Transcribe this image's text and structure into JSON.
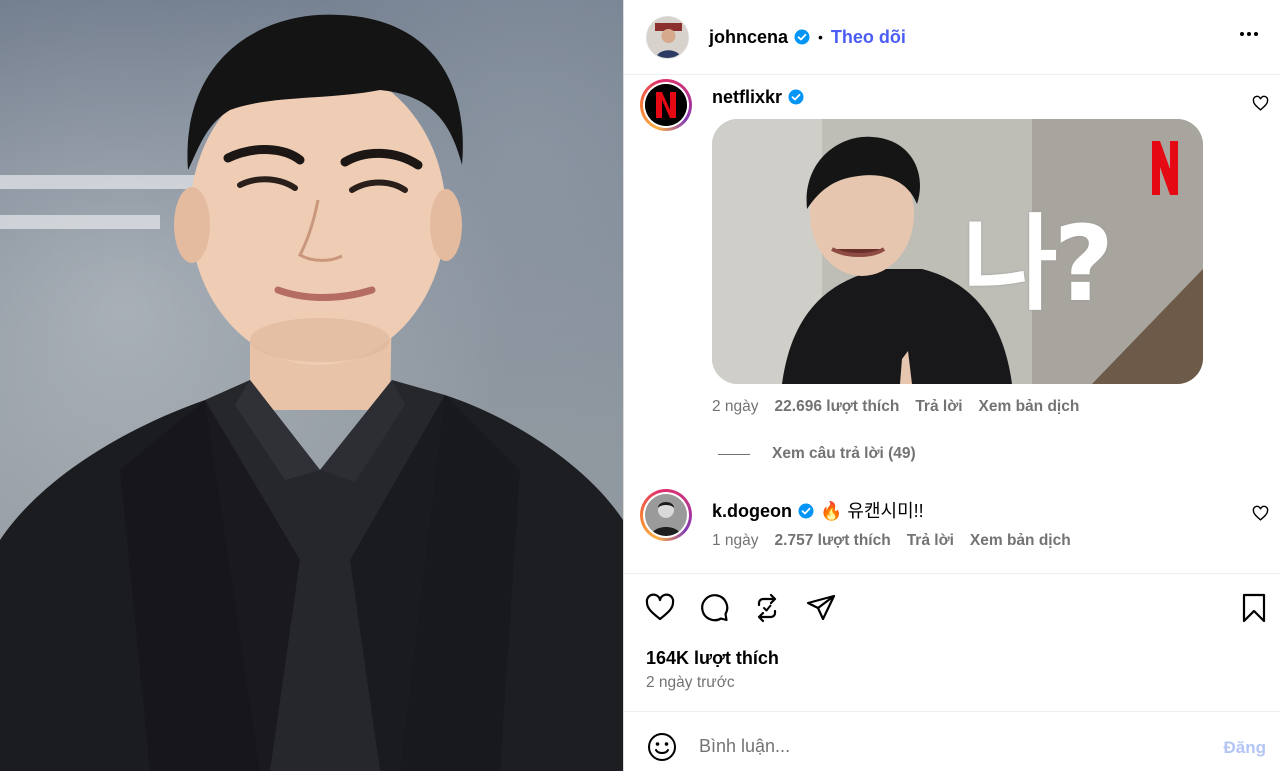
{
  "post": {
    "author": "johncena",
    "follow_label": "Theo dõi",
    "separator": "•",
    "likes": "164K lượt thích",
    "time_ago": "2 ngày trước"
  },
  "comments": [
    {
      "username": "netflixkr",
      "text": "",
      "media_text": "나?",
      "age": "2 ngày",
      "likes": "22.696 lượt thích",
      "reply_label": "Trả lời",
      "translate_label": "Xem bản dịch",
      "view_replies": "Xem câu trả lời (49)"
    },
    {
      "username": "k.dogeon",
      "text": "🔥 유캔시미!!",
      "age": "1 ngày",
      "likes": "2.757 lượt thích",
      "reply_label": "Trả lời",
      "translate_label": "Xem bản dịch"
    }
  ],
  "composer": {
    "placeholder": "Bình luận...",
    "post_label": "Đăng"
  },
  "colors": {
    "accent": "#4b5df5",
    "verified": "#0095f6",
    "muted": "#737373",
    "post_disabled": "#b3c5f5",
    "netflix_red": "#e50914"
  }
}
